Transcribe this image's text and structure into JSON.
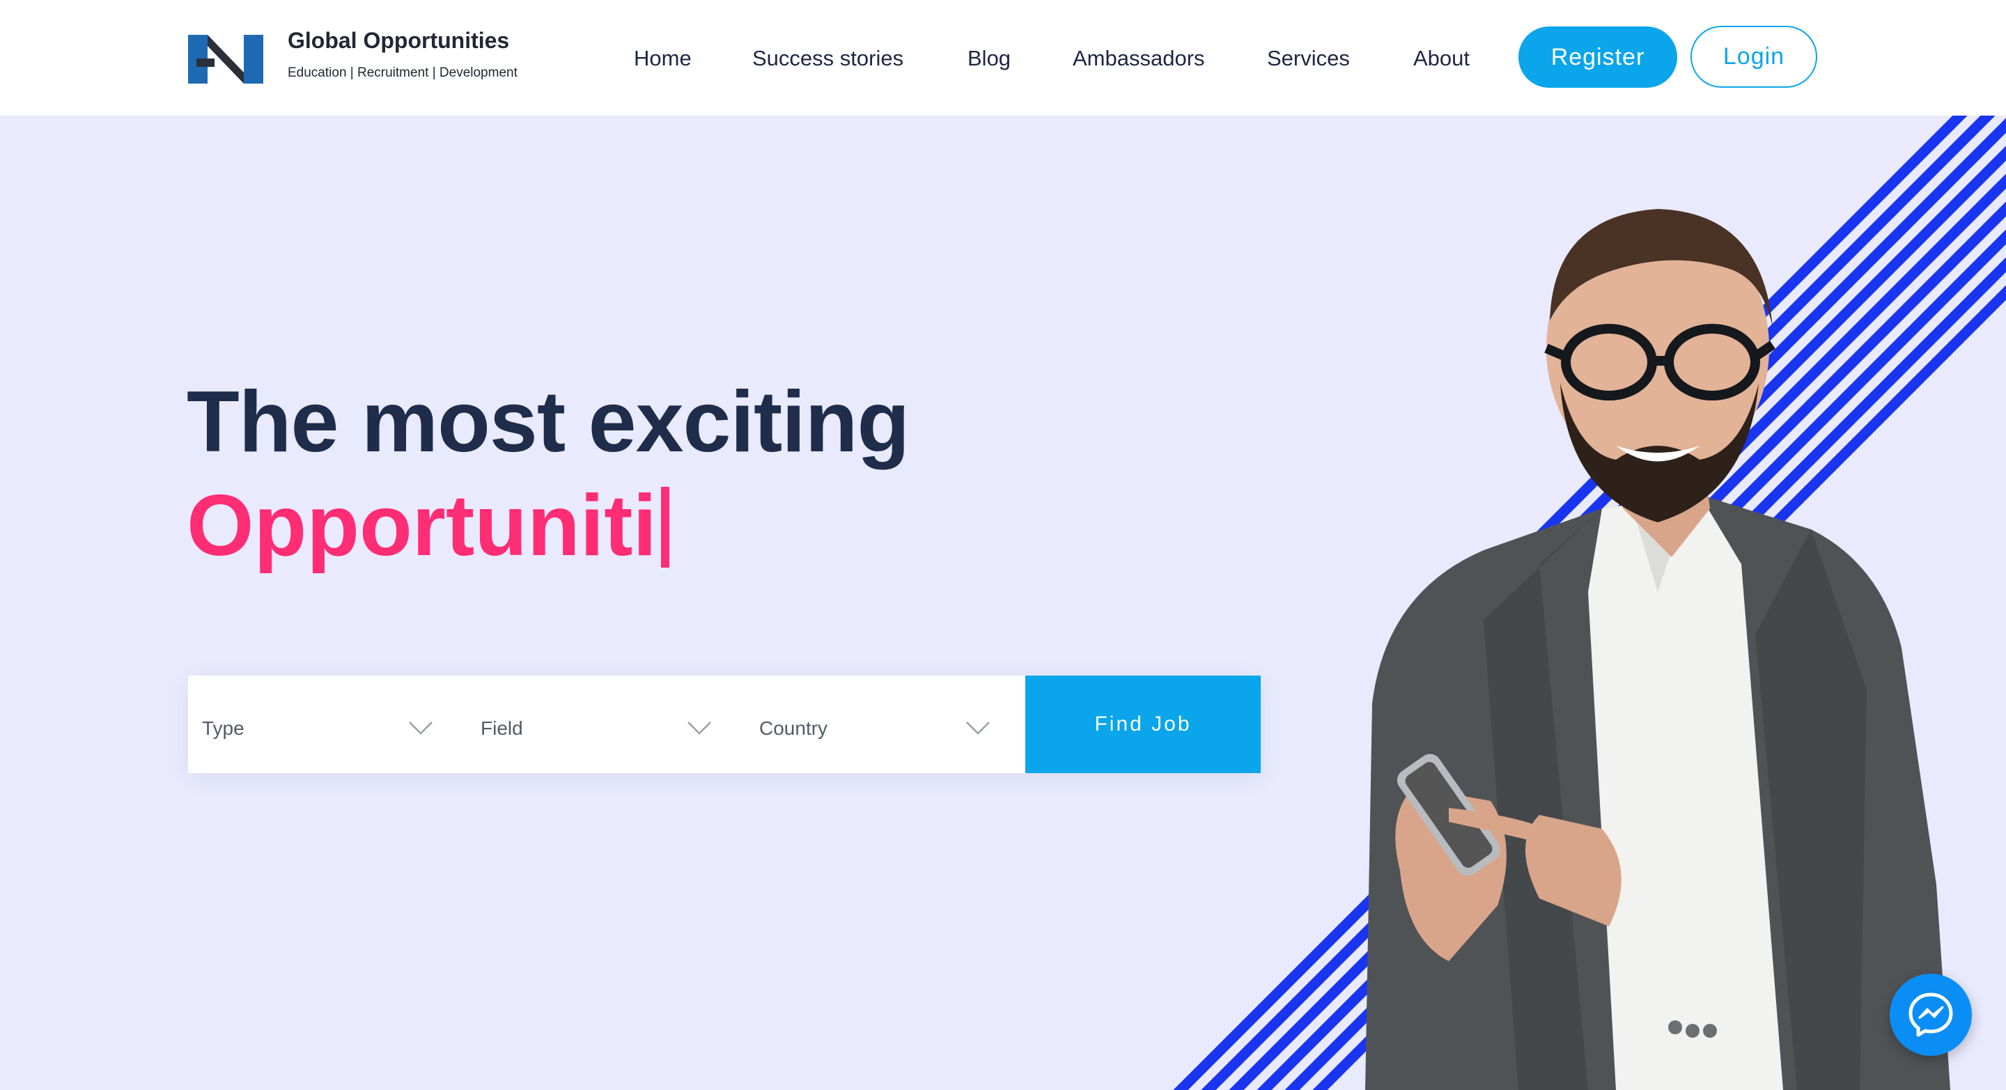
{
  "brand": {
    "name": "Global Opportunities",
    "tagline": "Education | Recruitment | Development",
    "logo_icon": "gn-monogram-logo"
  },
  "nav": {
    "items": [
      {
        "label": "Home"
      },
      {
        "label": "Success stories"
      },
      {
        "label": "Blog"
      },
      {
        "label": "Ambassadors"
      },
      {
        "label": "Services"
      },
      {
        "label": "About"
      }
    ],
    "register_label": "Register",
    "login_label": "Login"
  },
  "hero": {
    "headline_line1": "The most exciting",
    "headline_line2": "Opportuniti"
  },
  "search": {
    "type_label": "Type",
    "field_label": "Field",
    "country_label": "Country",
    "find_label": "Find Job"
  },
  "icons": {
    "chevron": "chevron-down-icon",
    "messenger": "messenger-icon"
  },
  "colors": {
    "background": "#e9eafd",
    "accent_blue": "#0aa5ea",
    "headline_dark": "#1f2d4b",
    "headline_pink": "#ff2d74",
    "stripe_blue": "#1a35f0",
    "messenger_blue": "#0a8ef6"
  }
}
